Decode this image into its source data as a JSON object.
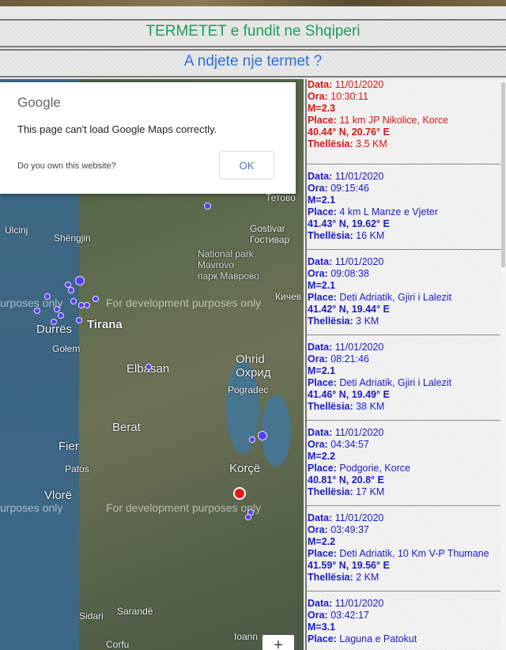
{
  "header": {
    "title": "TERMETET e fundit ne Shqiperi",
    "subtitle": "A ndjete nje termet ?"
  },
  "map": {
    "watermark": "For development purposes only",
    "watermark_left": "urposes only",
    "dialog": {
      "logo": "Google",
      "message": "This page can't load Google Maps correctly.",
      "link": "Do you own this website?",
      "ok": "OK"
    },
    "labels": {
      "tirana": "Tirana",
      "durres": "Durrës",
      "elbasan": "Elbasan",
      "berat": "Berat",
      "fier": "Fier",
      "patos": "Patos",
      "vlore": "Vlorë",
      "korce": "Korçë",
      "pogradec": "Pogradec",
      "ohrid": "Ohrid\nОхрид",
      "gostivar": "Gostivar\nГостивар",
      "ulcinj": "Ulcinj",
      "shengjin": "Shëngjin",
      "golem": "Golem",
      "sarande": "Sarandë",
      "corfu": "Corfu",
      "ioann": "Ioann",
      "national_park": "National park\nMavrovo\nпарк Маврово",
      "tetovo": "Тетово",
      "kicevo": "Кичев",
      "sidari": "Sidari"
    },
    "zoom_label": "+"
  },
  "colors": {
    "quake_marker": "#5b3cf2",
    "latest_marker": "#e21a1a",
    "title_green": "#1e9e57",
    "subtitle_blue": "#2a6fe0",
    "entry_blue": "#1a1ad0",
    "entry_red": "#e01414"
  },
  "quakes": [
    {
      "date_label": "Data:",
      "date": "11/01/2020",
      "time_label": "Ora:",
      "time": "10:30:11",
      "mag": "M=2.3",
      "place_label": "Place:",
      "place": "11 km JP Nikolice, Korce",
      "coords": "40.44° N, 20.76° E",
      "depth_label": "Thellësia:",
      "depth": "3.5 KM",
      "latest": true
    },
    {
      "date_label": "Data:",
      "date": "11/01/2020",
      "time_label": "Ora:",
      "time": "09:15:46",
      "mag": "M=2.1",
      "place_label": "Place:",
      "place": "4 km L Manze e Vjeter",
      "coords": "41.43° N, 19.62° E",
      "depth_label": "Thellësia:",
      "depth": "16 KM",
      "latest": false
    },
    {
      "date_label": "Data:",
      "date": "11/01/2020",
      "time_label": "Ora:",
      "time": "09:08:38",
      "mag": "M=2.1",
      "place_label": "Place:",
      "place": "Deti Adriatik, Gjiri i Lalezit",
      "coords": "41.42° N, 19.44° E",
      "depth_label": "Thellësia:",
      "depth": "3 KM",
      "latest": false
    },
    {
      "date_label": "Data:",
      "date": "11/01/2020",
      "time_label": "Ora:",
      "time": "08:21:46",
      "mag": "M=2.1",
      "place_label": "Place:",
      "place": "Deti Adriatik, Gjiri i Lalezit",
      "coords": "41.46° N, 19.49° E",
      "depth_label": "Thellësia:",
      "depth": "38 KM",
      "latest": false
    },
    {
      "date_label": "Data:",
      "date": "11/01/2020",
      "time_label": "Ora:",
      "time": "04:34:57",
      "mag": "M=2.2",
      "place_label": "Place:",
      "place": "Podgorie, Korce",
      "coords": "40.81° N, 20.8° E",
      "depth_label": "Thellësia:",
      "depth": "17 KM",
      "latest": false
    },
    {
      "date_label": "Data:",
      "date": "11/01/2020",
      "time_label": "Ora:",
      "time": "03:49:37",
      "mag": "M=2.2",
      "place_label": "Place:",
      "place": "Deti Adriatik, 10 Km V-P Thumane",
      "coords": "41.59° N, 19.56° E",
      "depth_label": "Thellësia:",
      "depth": "2 KM",
      "latest": false
    },
    {
      "date_label": "Data:",
      "date": "11/01/2020",
      "time_label": "Ora:",
      "time": "03:42:17",
      "mag": "M=3.1",
      "place_label": "Place:",
      "place": "Laguna e Patokut",
      "coords": "",
      "depth_label": "",
      "depth": "",
      "latest": false
    }
  ]
}
